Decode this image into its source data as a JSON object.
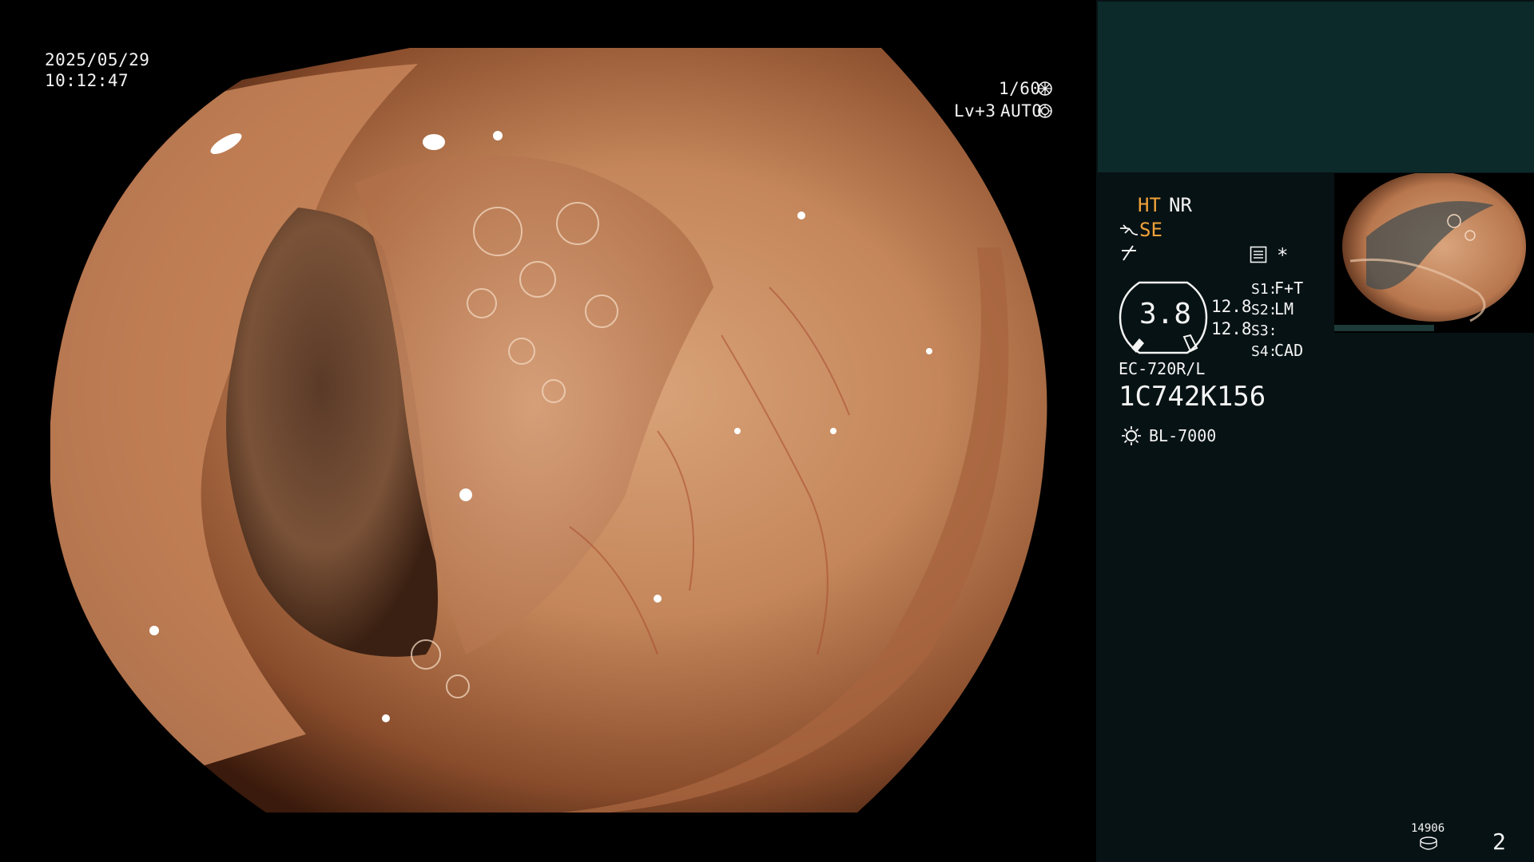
{
  "osd": {
    "date": "2025/05/29",
    "time": "10:12:47",
    "shutter": "1/60",
    "level": "Lv+3",
    "iris": "AUTO"
  },
  "panel": {
    "ht": "HT",
    "nr": "NR",
    "se": "SE",
    "asterisk": "*",
    "gauge_value": "3.8",
    "val_a": "12.8",
    "val_b": "12.8",
    "s1_label": "S1:",
    "s1_value": "F+T",
    "s2_label": "S2:",
    "s2_value": "LM",
    "s3_label": "S3:",
    "s3_value": "",
    "s4_label": "S4:",
    "s4_value": "CAD",
    "scope_model": "EC-720R/L",
    "scope_serial": "1C742K156",
    "light_source": "BL-7000",
    "counter": "14906",
    "page_number": "2"
  },
  "icons": {
    "shutter": "shutter-icon",
    "iris": "iris-icon",
    "hook": "hook-icon",
    "signal": "signal-icon",
    "menu": "menu-list-icon",
    "light": "sun-icon",
    "disk": "disk-icon"
  },
  "colors": {
    "accent": "#f0a23a",
    "panel_bg": "#071214",
    "teal": "#0d2a2a",
    "mucosa": "#c98a62"
  }
}
